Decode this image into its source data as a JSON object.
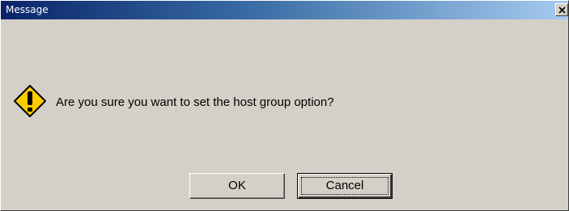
{
  "window": {
    "title": "Message",
    "close_icon": "close-icon"
  },
  "message": {
    "icon": "warning-icon",
    "text": "Are you sure you want to set the host group option?"
  },
  "buttons": {
    "ok_label": "OK",
    "cancel_label": "Cancel",
    "focused": "cancel"
  },
  "colors": {
    "titlebar_start": "#0a246a",
    "titlebar_end": "#a6caf0",
    "dialog_face": "#d4d0c8",
    "warning_fill": "#ffcc00"
  }
}
